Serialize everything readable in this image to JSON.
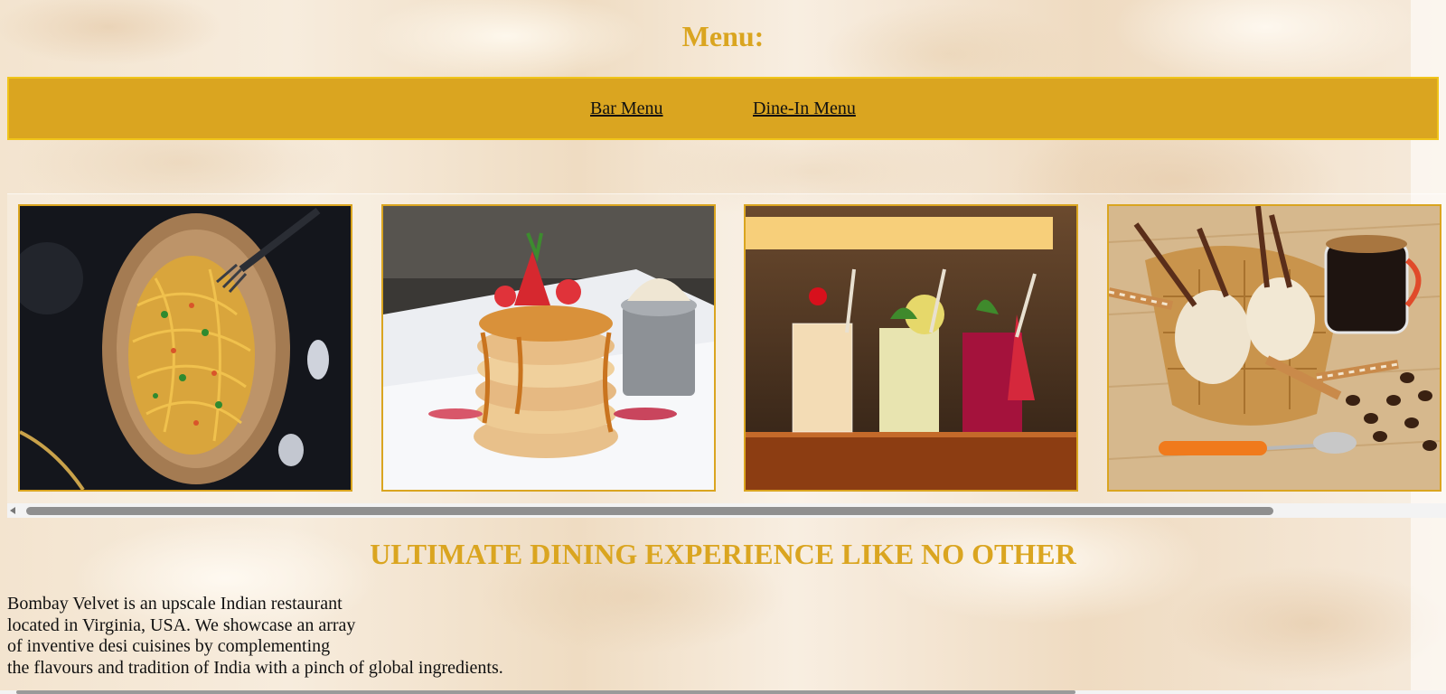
{
  "menu": {
    "title": "Menu:",
    "links": [
      "Bar Menu",
      "Dine-In Menu"
    ]
  },
  "gallery": {
    "photos": [
      "spaghetti-plate-photo",
      "pancake-stack-photo",
      "cocktail-glasses-photo",
      "waffle-dessert-coffee-photo"
    ]
  },
  "about": {
    "heading": "ULTIMATE DINING EXPERIENCE LIKE NO OTHER",
    "lines": [
      "Bombay Velvet is an upscale Indian restaurant",
      "located in Virginia, USA. We showcase an array",
      "of inventive desi cuisines by complementing",
      "the flavours and tradition of India with a pinch of global ingredients."
    ]
  },
  "colors": {
    "accent": "#daa520",
    "text": "#111111"
  }
}
